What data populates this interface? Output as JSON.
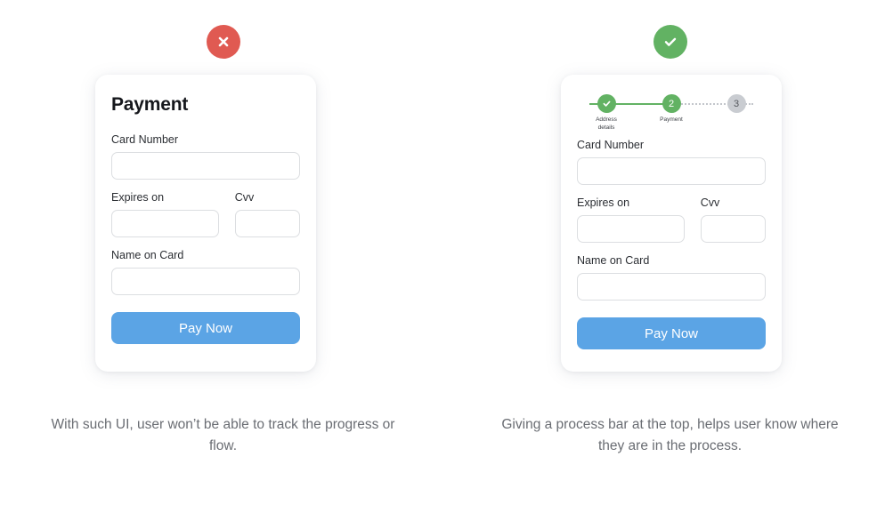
{
  "examples": [
    {
      "badge": {
        "icon": "close-icon",
        "color": "#e05a52",
        "aria": "bad example"
      },
      "card": {
        "title": "Payment",
        "has_progress": false,
        "fields": {
          "card_number_label": "Card Number",
          "expires_label": "Expires on",
          "cvv_label": "Cvv",
          "name_label": "Name on Card",
          "card_number_value": "",
          "expires_value": "",
          "cvv_value": "",
          "name_value": ""
        },
        "submit_label": "Pay Now"
      },
      "caption": "With such UI, user won’t be able to track the progress or flow."
    },
    {
      "badge": {
        "icon": "check-icon",
        "color": "#62b263",
        "aria": "good example"
      },
      "card": {
        "title": "",
        "has_progress": true,
        "progress": {
          "steps": [
            {
              "marker": "✓",
              "label": "Address\ndetails",
              "state": "done"
            },
            {
              "marker": "2",
              "label": "Payment",
              "state": "current"
            },
            {
              "marker": "3",
              "label": "",
              "state": "todo"
            }
          ],
          "done_color": "#62b263",
          "todo_color": "#c9ccd1"
        },
        "fields": {
          "card_number_label": "Card Number",
          "expires_label": "Expires on",
          "cvv_label": "Cvv",
          "name_label": "Name on Card",
          "card_number_value": "",
          "expires_value": "",
          "cvv_value": "",
          "name_value": ""
        },
        "submit_label": "Pay Now"
      },
      "caption": "Giving a process bar at the top, helps user know where they are in the process."
    }
  ],
  "theme": {
    "background": "#ffffff",
    "accent_button": "#5ba4e5",
    "success": "#62b263",
    "error": "#e05a52",
    "caption_color": "#6a6d73"
  }
}
